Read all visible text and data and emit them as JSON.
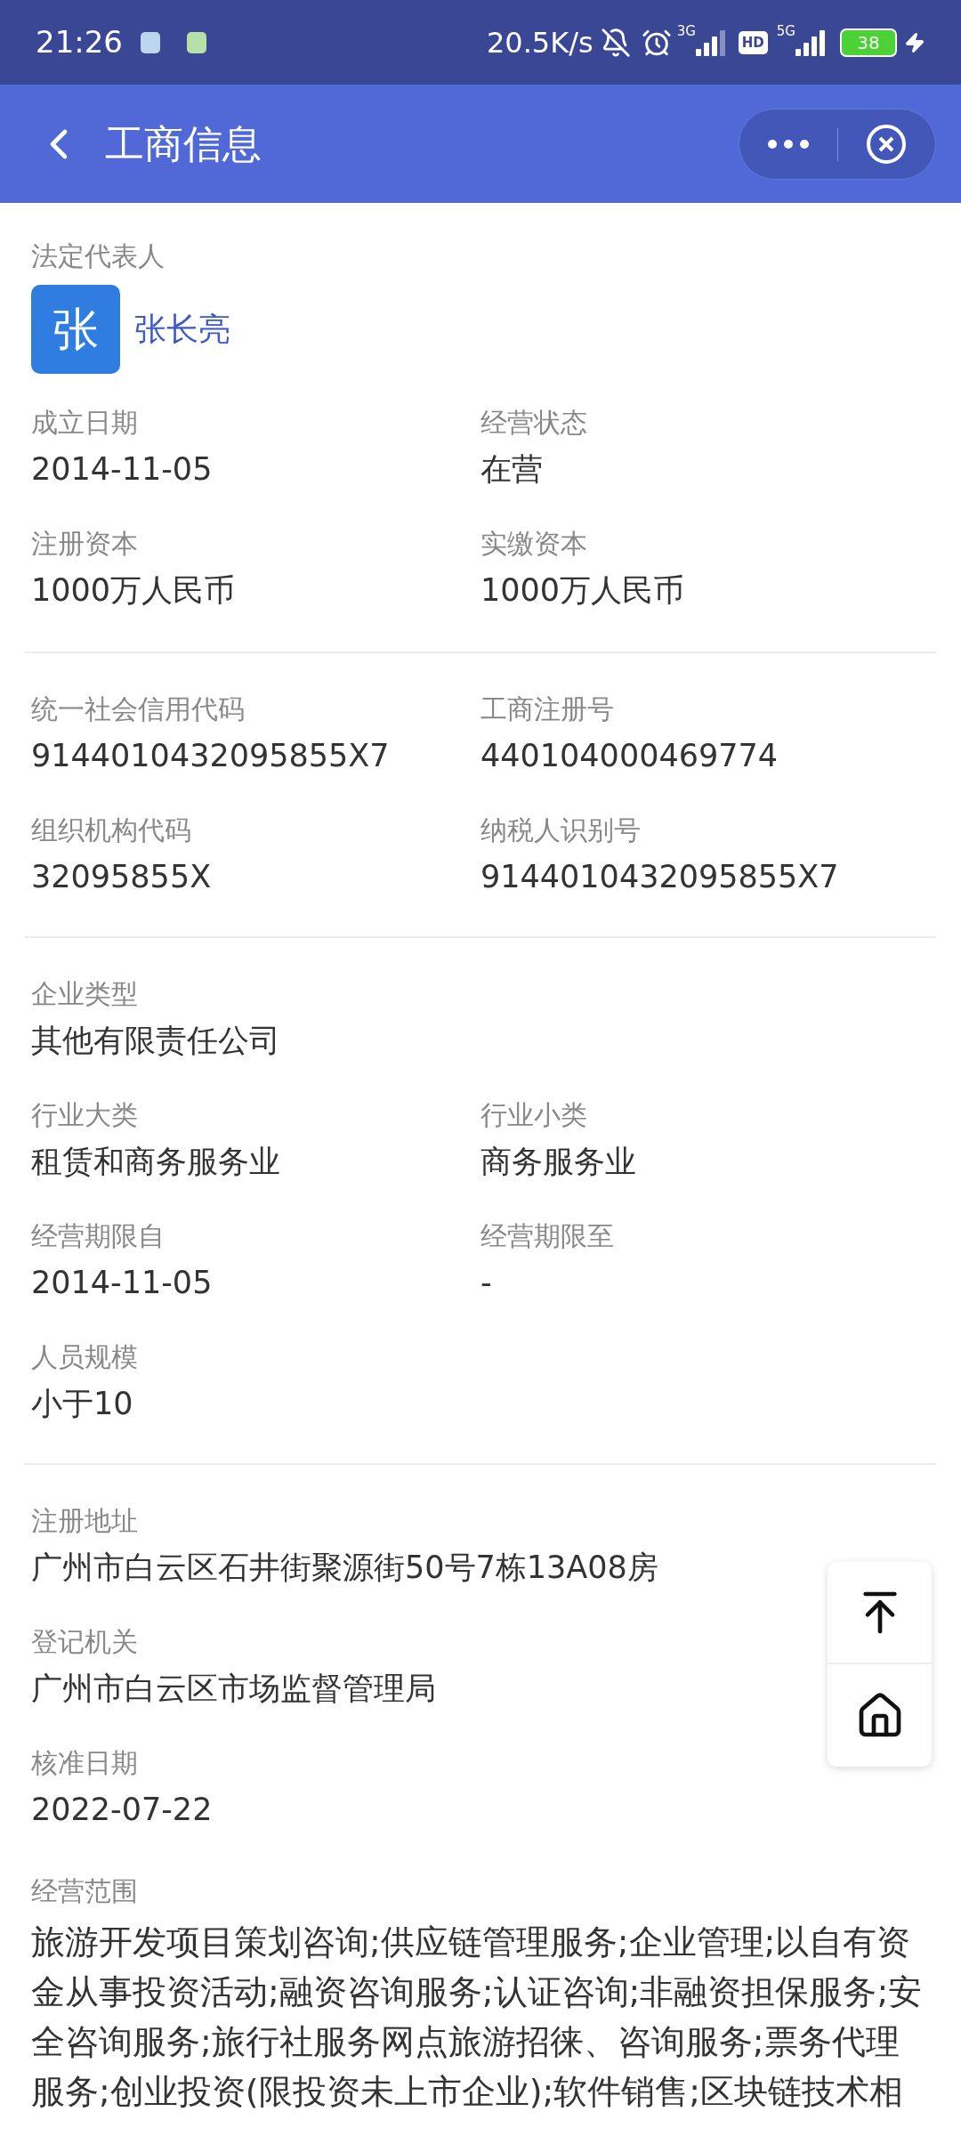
{
  "status_bar": {
    "time": "21:26",
    "net_speed": "20.5K/s",
    "sim1_type": "3G",
    "hd": "HD",
    "sim2_type": "5G",
    "battery": "38"
  },
  "header": {
    "title": "工商信息"
  },
  "legal_rep": {
    "label": "法定代表人",
    "avatar_char": "张",
    "name": "张长亮"
  },
  "sections": [
    {
      "fields": [
        {
          "kind": "half",
          "label": "成立日期",
          "value": "2014-11-05"
        },
        {
          "kind": "half",
          "label": "经营状态",
          "value": "在营"
        },
        {
          "kind": "half",
          "label": "注册资本",
          "value": "1000万人民币"
        },
        {
          "kind": "half",
          "label": "实缴资本",
          "value": "1000万人民币"
        }
      ]
    },
    {
      "fields": [
        {
          "kind": "half",
          "label": "统一社会信用代码",
          "value": "9144010432095855X7"
        },
        {
          "kind": "half",
          "label": "工商注册号",
          "value": "440104000469774"
        },
        {
          "kind": "half",
          "label": "组织机构代码",
          "value": "32095855X"
        },
        {
          "kind": "half",
          "label": "纳税人识别号",
          "value": "9144010432095855X7"
        }
      ]
    },
    {
      "fields": [
        {
          "kind": "full",
          "label": "企业类型",
          "value": "其他有限责任公司"
        },
        {
          "kind": "half",
          "label": "行业大类",
          "value": "租赁和商务服务业"
        },
        {
          "kind": "half",
          "label": "行业小类",
          "value": "商务服务业"
        },
        {
          "kind": "half",
          "label": "经营期限自",
          "value": "2014-11-05"
        },
        {
          "kind": "half",
          "label": "经营期限至",
          "value": "-"
        },
        {
          "kind": "full",
          "label": "人员规模",
          "value": "小于10"
        }
      ]
    },
    {
      "fields": [
        {
          "kind": "full",
          "label": "注册地址",
          "value": "广州市白云区石井街聚源街50号7栋13A08房"
        },
        {
          "kind": "full",
          "label": "登记机关",
          "value": "广州市白云区市场监督管理局"
        },
        {
          "kind": "full",
          "label": "核准日期",
          "value": "2022-07-22"
        }
      ]
    }
  ],
  "scope": {
    "label": "经营范围",
    "text": "旅游开发项目策划咨询;供应链管理服务;企业管理;以自有资金从事投资活动;融资咨询服务;认证咨询;非融资担保服务;安全咨询服务;旅行社服务网点旅游招徕、咨询服务;票务代理服务;创业投资(限投资未上市企业);软件销售;区块链技术相"
  }
}
